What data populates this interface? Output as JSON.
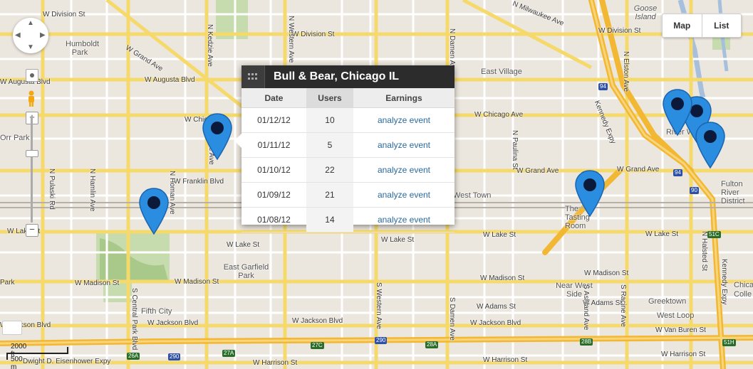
{
  "map_controls": {
    "map_label": "Map",
    "list_label": "List",
    "pan_icon": "pan-icon",
    "pegman_icon": "pegman-icon",
    "zoom_in": "+",
    "zoom_out": "−"
  },
  "scale": {
    "feet": "2000 ft",
    "meters": "500 m"
  },
  "popup": {
    "title": "Bull & Bear, Chicago IL",
    "headers": [
      "Date",
      "Users",
      "Earnings"
    ],
    "rows": [
      {
        "date": "01/12/12",
        "users": "10",
        "action": "analyze event"
      },
      {
        "date": "01/11/12",
        "users": "5",
        "action": "analyze event"
      },
      {
        "date": "01/10/12",
        "users": "22",
        "action": "analyze event"
      },
      {
        "date": "01/09/12",
        "users": "21",
        "action": "analyze event"
      },
      {
        "date": "01/08/12",
        "users": "14",
        "action": "analyze event"
      }
    ]
  },
  "pins": [
    "pin",
    "pin",
    "pin",
    "pin",
    "pin",
    "pin"
  ],
  "map_labels": {
    "humboldt_park": "Humboldt Park",
    "w_division_st_left": "W Division St",
    "w_division_st_mid": "W Division St",
    "w_division_st_right": "W Division St",
    "w_grand_ave_left": "W Grand Ave",
    "w_grand_ave_right": "W Grand Ave",
    "w_augusta_blvd_left": "W Augusta Blvd",
    "w_augusta_blvd_mid": "W Augusta Blvd",
    "w_chicago_ave": "W Chicago Ave",
    "w_chic": "W Chic",
    "w_franklin_blvd": "W Franklin Blvd",
    "w_lake_st_left": "W Lake St",
    "w_lake_st_mid": "W Lake St",
    "w_lake_st_right": "W Lake St",
    "w_madison_st_left": "W Madison St",
    "w_madison_st_mid": "W Madison St",
    "w_madison_st_right1": "W Madison St",
    "w_madison_st_right2": "W Madison St",
    "w_jackson_blvd_left": "W Jackson Blvd",
    "w_jackson_blvd_mid": "W Jackson Blvd",
    "w_jackson_blvd_right": "W Jackson Blvd",
    "w_adams_st_mid": "W Adams St",
    "w_adams_st_right": "W Adams St",
    "w_van_buren_st": "W Van Buren St",
    "w_harrison_st_left": "W Harrison St",
    "w_harrison_st_mid": "W Harrison St",
    "w_harrison_st_right": "W Harrison St",
    "east_village": "East Village",
    "west_town": "West Town",
    "east_garfield_park": "East Garfield Park",
    "fifth_city": "Fifth City",
    "near_west_side": "Near West Side",
    "greektown": "Greektown",
    "west_loop": "West Loop",
    "fulton_river_district": "Fulton River District",
    "river_w": "River W",
    "goose_island": "Goose Island",
    "the_tasting_room": "The Tasting Room",
    "kennedy_expy": "Kennedy Expy",
    "kennedy_expy_right": "Kennedy Expy",
    "eisenhower_expy": "Dwight D. Eisenhower Expy",
    "n_kedzie_ave": "N Kedzie Ave",
    "n_pulaski_rd": "N Pulaski Rd",
    "n_hamlin_ave": "N Hamlin Ave",
    "n_homan_ave": "N Homan Ave",
    "s_central_park_blvd": "S Central Park Blvd",
    "n_damen_ave": "N Damen Ave",
    "n_western_ave": "N Western Ave",
    "s_western_ave": "S Western Ave",
    "s_damen_ave": "S Damen Ave",
    "n_paulina_st": "N Paulina St",
    "n_elston_ave": "N Elston Ave",
    "n_halsted_st": "N Halsted St",
    "s_racine_ave": "S Racine Ave",
    "s_ashland_ave": "S Ashland Ave",
    "w_milwaukee_ave": "N Milwaukee Ave",
    "orr_park": "Orr Park",
    "park": "Park",
    "chicago": "Chicag",
    "colle": "Colle",
    "augusta_blvd": "Augusta Blvd",
    "ave_frag": "e Ave"
  },
  "shields": {
    "i94_top": "94",
    "i94_mid": "94",
    "i90": "90",
    "i290_left": "290",
    "i290_mid": "290",
    "e26a_left": "26A",
    "e27a": "27A",
    "e27c": "27C",
    "e28a": "28A",
    "e28b": "28B",
    "e51c": "51C",
    "e51h": "51H"
  }
}
